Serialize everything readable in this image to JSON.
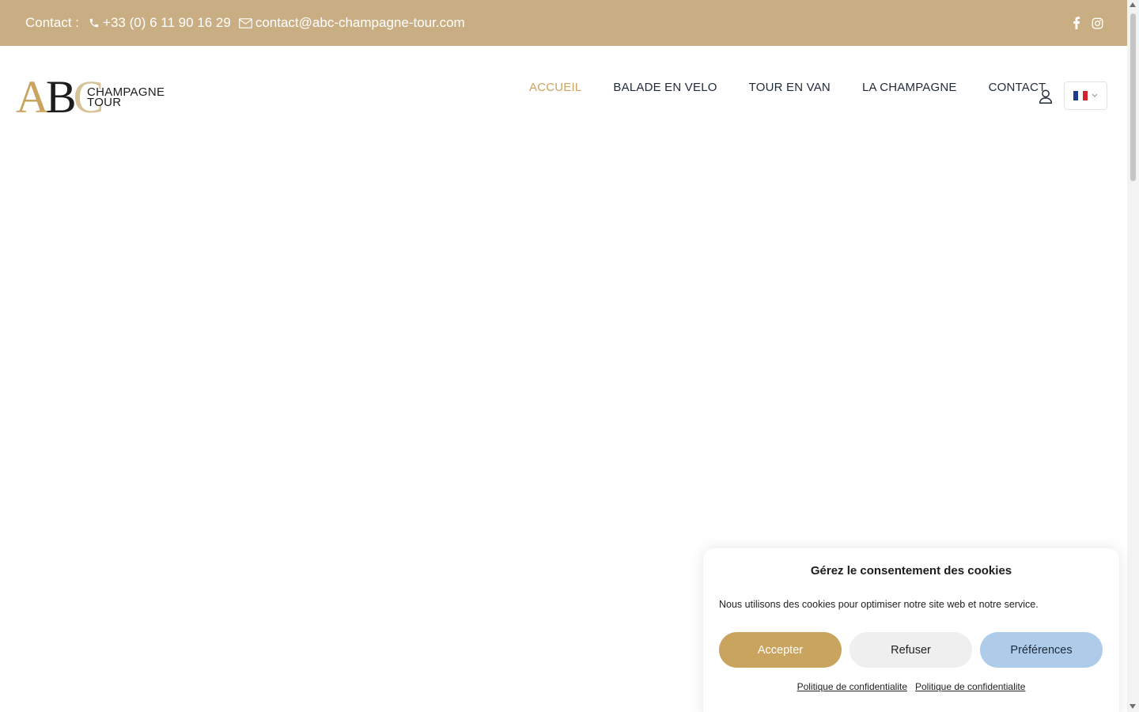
{
  "topbar": {
    "contact_label": "Contact :",
    "phone": "+33 (0) 6 11 90 16 29",
    "email": "contact@abc-champagne-tour.com",
    "bg_color": "#c9ae84"
  },
  "logo": {
    "letter_a": "A",
    "letter_b": "B",
    "letter_c": "C",
    "line1": "CHAMPAGNE",
    "line2": "TOUR"
  },
  "nav": {
    "items": [
      {
        "label": "ACCUEIL",
        "active": true
      },
      {
        "label": "BALADE EN VELO",
        "active": false
      },
      {
        "label": "TOUR EN VAN",
        "active": false
      },
      {
        "label": "LA CHAMPAGNE",
        "active": false
      },
      {
        "label": "CONTACT",
        "active": false
      }
    ],
    "accent_color": "#c9a45f"
  },
  "language": {
    "selected": "fr-flag-icon"
  },
  "icons": {
    "phone": "phone-icon",
    "email": "envelope-icon",
    "facebook": "facebook-icon",
    "instagram": "instagram-icon",
    "user": "user-icon",
    "chevron": "chevron-down-icon"
  },
  "cookie": {
    "title": "Gérez le consentement des cookies",
    "message": "Nous utilisons des cookies pour optimiser notre site web et notre service.",
    "accept_label": "Accepter",
    "refuse_label": "Refuser",
    "prefs_label": "Préférences",
    "link1": "Politique de confidentialite",
    "link2": "Politique de confidentialite",
    "accept_color": "#c9a45f",
    "prefs_color": "#aecbea"
  }
}
